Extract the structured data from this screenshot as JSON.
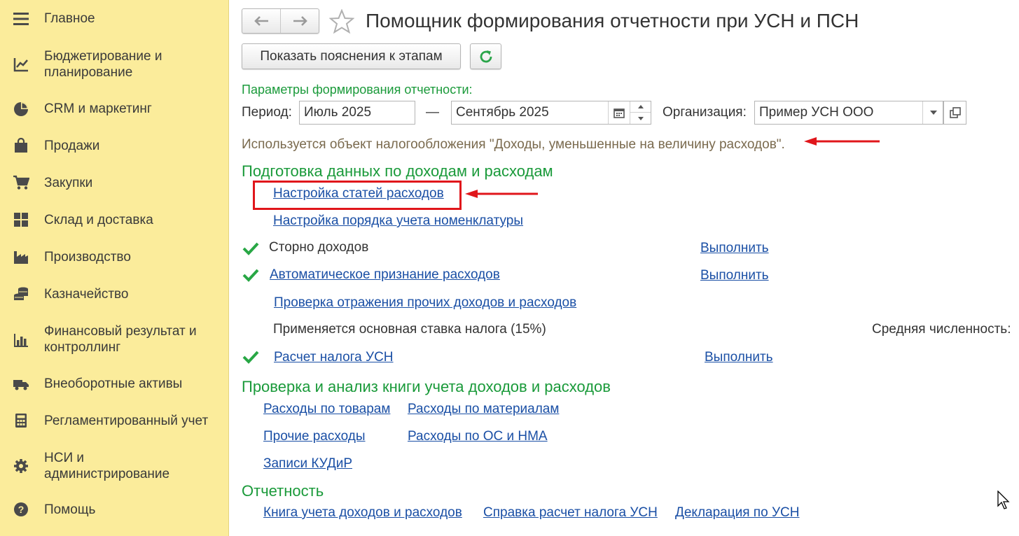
{
  "sidebar": {
    "items": [
      {
        "label": "Главное",
        "icon": "menu-lines-icon"
      },
      {
        "label": "Бюджетирование и\nпланирование",
        "icon": "budget-chart-icon"
      },
      {
        "label": "CRM и маркетинг",
        "icon": "pie-chart-icon"
      },
      {
        "label": "Продажи",
        "icon": "shopping-bag-icon"
      },
      {
        "label": "Закупки",
        "icon": "cart-icon"
      },
      {
        "label": "Склад и доставка",
        "icon": "warehouse-grid-icon"
      },
      {
        "label": "Производство",
        "icon": "factory-icon"
      },
      {
        "label": "Казначейство",
        "icon": "coins-icon"
      },
      {
        "label": "Финансовый результат и\nконтроллинг",
        "icon": "bar-chart-icon"
      },
      {
        "label": "Внеоборотные активы",
        "icon": "truck-icon"
      },
      {
        "label": "Регламентированный учет",
        "icon": "calculator-icon"
      },
      {
        "label": "НСИ и\nадминистрирование",
        "icon": "gear-icon"
      },
      {
        "label": "Помощь",
        "icon": "question-icon"
      }
    ]
  },
  "header": {
    "title": "Помощник формирования отчетности при УСН и ПСН",
    "show_hints_label": "Показать пояснения к этапам"
  },
  "params": {
    "section_label": "Параметры формирования отчетности:",
    "period_label": "Период:",
    "period_from": "Июль 2025",
    "dash": "—",
    "period_to": "Сентябрь 2025",
    "org_label": "Организация:",
    "org_value": "Пример УСН ООО",
    "tax_object_note": "Используется объект налогообложения \"Доходы, уменьшенные на величину расходов\"."
  },
  "prep": {
    "heading": "Подготовка данных по доходам и расходам",
    "expense_items_link": "Настройка статей расходов",
    "nomenclature_link": "Настройка порядка учета номенклатуры",
    "storno_label": "Сторно доходов",
    "storno_action": "Выполнить",
    "auto_expenses_link": "Автоматическое признание расходов",
    "auto_expenses_action": "Выполнить",
    "other_check_link": "Проверка отражения прочих доходов и расходов",
    "rate_text": "Применяется основная ставка налога (15%)",
    "avg_headcount_label": "Средняя численность:",
    "tax_calc_link": "Расчет налога УСН",
    "tax_calc_action": "Выполнить"
  },
  "analysis": {
    "heading": "Проверка и анализ книги учета доходов и расходов",
    "goods_link": "Расходы по товарам",
    "materials_link": "Расходы по материалам",
    "other_link": "Прочие расходы",
    "assets_link": "Расходы по ОС и НМА",
    "kudir_link": "Записи КУДиР"
  },
  "reporting": {
    "heading": "Отчетность",
    "book_link": "Книга учета доходов и расходов",
    "tax_statement_link": "Справка расчет налога УСН",
    "declaration_link": "Декларация по УСН"
  },
  "colors": {
    "sidebar_bg": "#fbec9b",
    "link": "#1a4fa5",
    "heading_green": "#1a9a3a",
    "annotation_red": "#e0161b"
  }
}
